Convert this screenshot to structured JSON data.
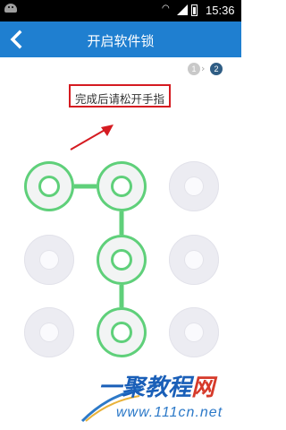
{
  "status_bar": {
    "time": "15:36"
  },
  "header": {
    "title": "开启软件锁"
  },
  "steps": {
    "first": "1",
    "second": "2"
  },
  "instruction": "完成后请松开手指",
  "pattern": {
    "grid": [
      "1",
      "2",
      "3",
      "4",
      "5",
      "6",
      "7",
      "8",
      "9"
    ],
    "selected_order": [
      "1",
      "2",
      "5",
      "8"
    ]
  },
  "watermark": {
    "brand": "一聚教程",
    "brand_suffix": "网",
    "domain": "www.111cn.net"
  },
  "colors": {
    "header": "#1f7fd0",
    "selected": "#5fd07a",
    "highlight_box": "#d51b21"
  }
}
